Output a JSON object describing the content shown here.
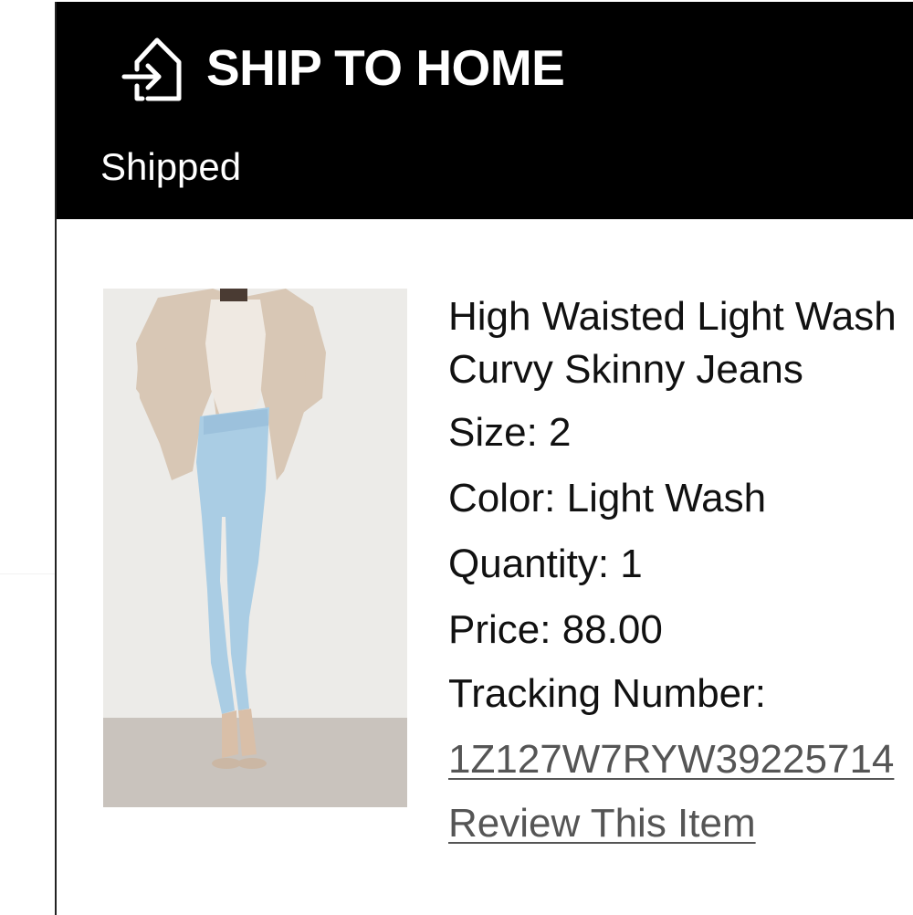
{
  "header": {
    "title": "SHIP TO HOME",
    "status": "Shipped",
    "icon": "house-arrow-icon"
  },
  "product": {
    "name": "High Waisted Light Wash Curvy Skinny Jeans",
    "image_icon": "product-photo",
    "size": "Size: 2",
    "color": "Color: Light Wash",
    "quantity": "Quantity: 1",
    "price": "Price: 88.00",
    "tracking_label": "Tracking Number:",
    "tracking_number": "1Z127W7RYW39225714",
    "review_link": "Review This Item"
  },
  "colors": {
    "header_bg": "#000000",
    "header_text": "#ffffff",
    "link": "#555555"
  }
}
